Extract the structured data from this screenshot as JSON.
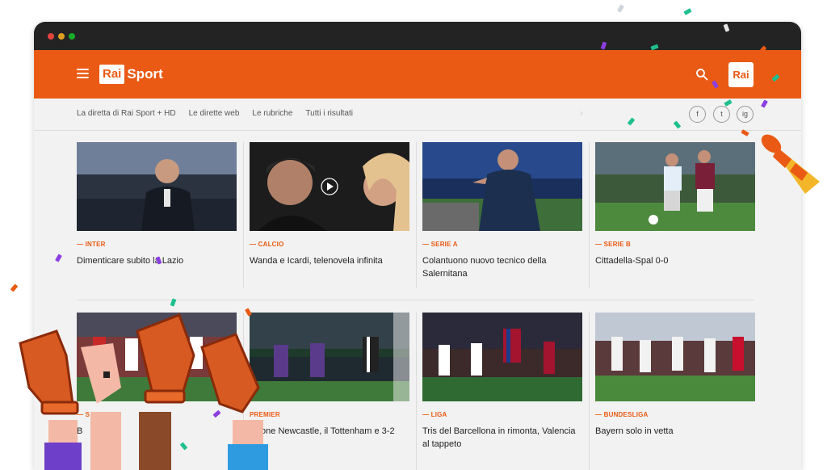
{
  "header": {
    "brand_rai": "Rai",
    "brand_sport": "Sport",
    "rai_logo": "Rai",
    "accent_color": "#ea5a14"
  },
  "subnav": {
    "links": [
      "La diretta di Rai Sport + HD",
      "Le dirette web",
      "Le rubriche",
      "Tutti i risultati"
    ],
    "social": [
      "f",
      "t",
      "ig"
    ]
  },
  "articles": [
    {
      "category": "— INTER",
      "title": "Dimenticare subito la Lazio"
    },
    {
      "category": "— CALCIO",
      "title": "Wanda e Icardi, telenovela infinita"
    },
    {
      "category": "— SERIE A",
      "title": "Colantuono nuovo tecnico della Salernitana"
    },
    {
      "category": "— SERIE B",
      "title": "Cittadella-Spal 0-0"
    },
    {
      "category": "— S",
      "title": "B"
    },
    {
      "category": "PREMIER",
      "title": "usione Newcastle, il Tottenham e 3-2"
    },
    {
      "category": "— LIGA",
      "title": "Tris del Barcellona in rimonta, Valencia al tappeto"
    },
    {
      "category": "— BUNDESLIGA",
      "title": "Bayern solo in vetta"
    }
  ],
  "icons": [
    "hamburger-menu-icon",
    "search-icon",
    "play-icon",
    "party-popper-icon",
    "foam-finger-hands-icon"
  ]
}
